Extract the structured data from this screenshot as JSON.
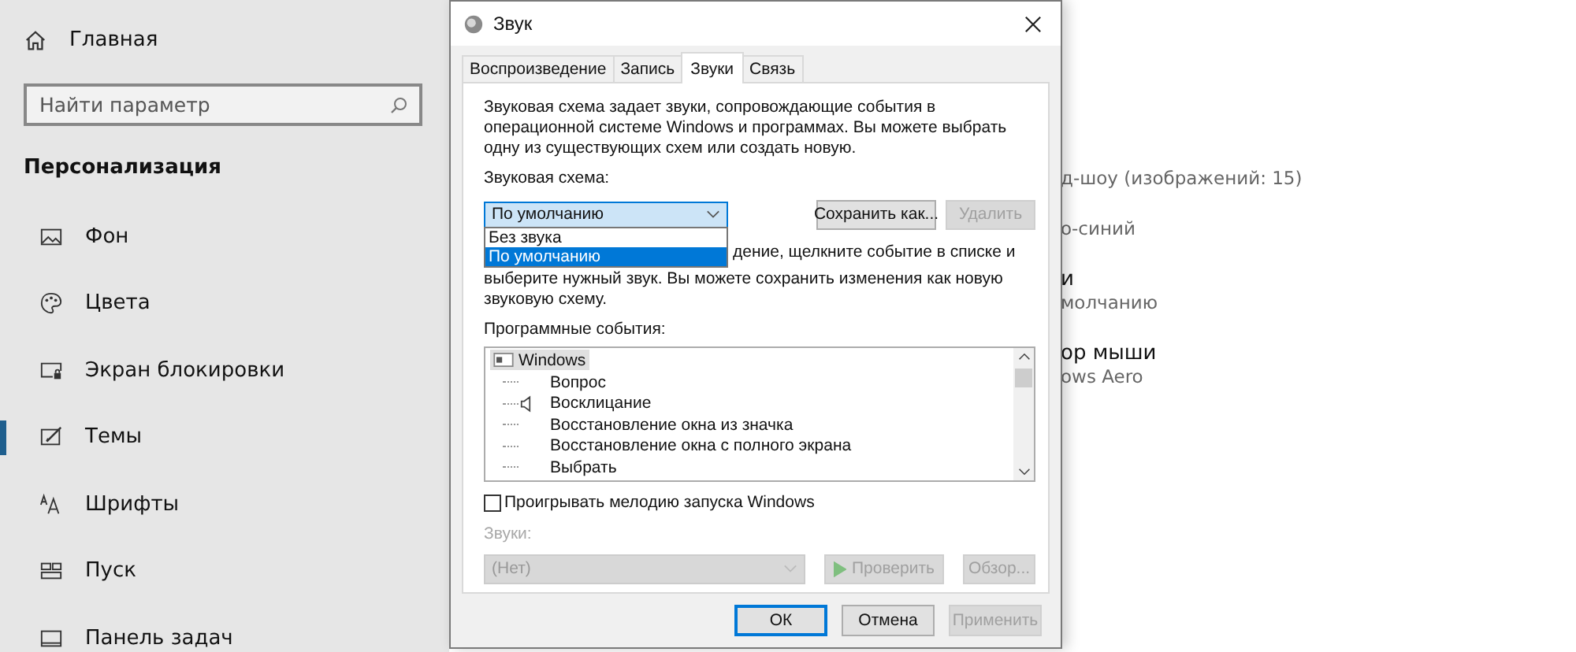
{
  "settings_sidebar": {
    "home": "Главная",
    "search": {
      "placeholder": "Найти параметр"
    },
    "section": "Персонализация",
    "items": [
      {
        "label": "Фон",
        "selected": false
      },
      {
        "label": "Цвета",
        "selected": false
      },
      {
        "label": "Экран блокировки",
        "selected": false
      },
      {
        "label": "Темы",
        "selected": true
      },
      {
        "label": "Шрифты",
        "selected": false
      },
      {
        "label": "Пуск",
        "selected": false
      },
      {
        "label": "Панель задач",
        "selected": false
      }
    ]
  },
  "background_page": {
    "rows": [
      {
        "value": "д-шоу (изображений: 15)"
      },
      {
        "value": "о-синий"
      },
      {
        "title": "и",
        "value": "молчанию"
      },
      {
        "title": "ор мыши",
        "value": "ows Aero"
      }
    ]
  },
  "dialog": {
    "title": "Звук",
    "tabs": [
      {
        "label": "Воспроизведение",
        "selected": false
      },
      {
        "label": "Запись",
        "selected": false
      },
      {
        "label": "Звуки",
        "selected": true
      },
      {
        "label": "Связь",
        "selected": false
      }
    ],
    "description": "Звуковая схема задает звуки, сопровождающие события в операционной системе Windows и программах. Вы можете выбрать одну из существующих схем или создать новую.",
    "scheme_label": "Звуковая схема:",
    "scheme_select": {
      "value": "По умолчанию",
      "expanded": true
    },
    "scheme_options": [
      {
        "label": "Без звука",
        "selected": false
      },
      {
        "label": "По умолчанию",
        "selected": true
      }
    ],
    "scheme_buttons": [
      {
        "label": "Сохранить как...",
        "disabled": false
      },
      {
        "label": "Удалить",
        "disabled": true
      }
    ],
    "hint_line_1": "дение, щелкните событие в списке и",
    "hint_rest": "выберите нужный звук. Вы можете сохранить изменения как новую звуковую схему.",
    "events_label": "Программные события:",
    "events": {
      "label": "Windows",
      "selected": true,
      "children": [
        {
          "label": "Вопрос",
          "sound": false,
          "selected": false
        },
        {
          "label": "Восклицание",
          "sound": true,
          "selected": false
        },
        {
          "label": "Восстановление окна из значка",
          "sound": false,
          "selected": false
        },
        {
          "label": "Восстановление окна с полного экрана",
          "sound": false,
          "selected": false
        },
        {
          "label": "Выбрать",
          "sound": false,
          "selected": false
        }
      ]
    },
    "startup_checkbox": {
      "label": "Проигрывать мелодию запуска Windows",
      "checked": false
    },
    "sounds_label": {
      "text": "Звуки:",
      "disabled": true
    },
    "sound_select": {
      "value": "(Нет)",
      "disabled": true
    },
    "sound_buttons": [
      {
        "label": "Проверить",
        "kind": "play",
        "disabled": true
      },
      {
        "label": "Обзор...",
        "kind": "plain",
        "disabled": true
      }
    ],
    "footer_buttons": [
      {
        "label": "ОК",
        "disabled": false,
        "focused": true
      },
      {
        "label": "Отмена",
        "disabled": false,
        "focused": false
      },
      {
        "label": "Применить",
        "disabled": true,
        "focused": false
      }
    ]
  }
}
